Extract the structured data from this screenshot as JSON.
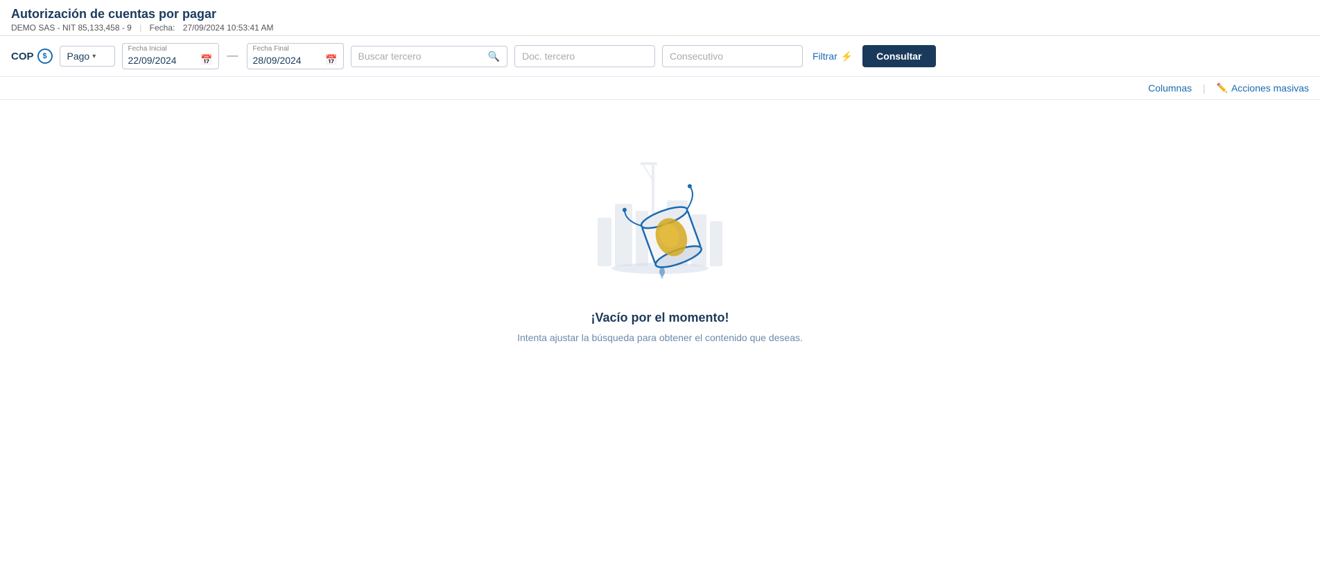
{
  "header": {
    "title": "Autorización de cuentas por pagar",
    "company": "DEMO SAS - NIT 85,133,458 - 9",
    "fecha_label": "Fecha:",
    "fecha_value": "27/09/2024 10:53:41 AM"
  },
  "toolbar": {
    "currency": "COP",
    "currency_icon": "$",
    "pago_label": "Pago",
    "fecha_inicial_label": "Fecha Inicial",
    "fecha_inicial_value": "22/09/2024",
    "fecha_final_label": "Fecha Final",
    "fecha_final_value": "28/09/2024",
    "buscar_tercero_placeholder": "Buscar tercero",
    "doc_tercero_placeholder": "Doc. tercero",
    "consecutivo_placeholder": "Consecutivo",
    "filtrar_label": "Filtrar",
    "consultar_label": "Consultar"
  },
  "action_bar": {
    "columns_label": "Columnas",
    "acciones_label": "Acciones masivas"
  },
  "empty_state": {
    "title": "¡Vacío por el momento!",
    "subtitle": "Intenta ajustar la búsqueda para obtener el contenido que deseas."
  }
}
